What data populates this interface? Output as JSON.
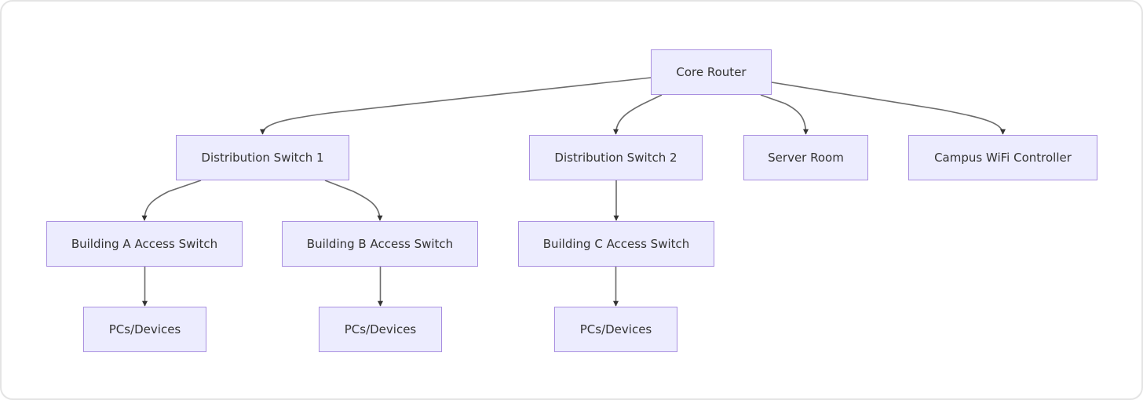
{
  "diagram": {
    "type": "flowchart",
    "direction": "top-down",
    "colors": {
      "node_fill": "#ececfe",
      "node_border": "#a98fe0",
      "edge": "#6b6b6b",
      "text": "#333333"
    },
    "nodes": [
      {
        "id": "core",
        "label": "Core Router"
      },
      {
        "id": "dist1",
        "label": "Distribution Switch 1"
      },
      {
        "id": "dist2",
        "label": "Distribution Switch 2"
      },
      {
        "id": "server",
        "label": "Server Room"
      },
      {
        "id": "wifi",
        "label": "Campus WiFi Controller"
      },
      {
        "id": "accA",
        "label": "Building A Access Switch"
      },
      {
        "id": "accB",
        "label": "Building B Access Switch"
      },
      {
        "id": "accC",
        "label": "Building C Access Switch"
      },
      {
        "id": "pcA",
        "label": "PCs/Devices"
      },
      {
        "id": "pcB",
        "label": "PCs/Devices"
      },
      {
        "id": "pcC",
        "label": "PCs/Devices"
      }
    ],
    "edges": [
      {
        "from": "core",
        "to": "dist1"
      },
      {
        "from": "core",
        "to": "dist2"
      },
      {
        "from": "core",
        "to": "server"
      },
      {
        "from": "core",
        "to": "wifi"
      },
      {
        "from": "dist1",
        "to": "accA"
      },
      {
        "from": "dist1",
        "to": "accB"
      },
      {
        "from": "dist2",
        "to": "accC"
      },
      {
        "from": "accA",
        "to": "pcA"
      },
      {
        "from": "accB",
        "to": "pcB"
      },
      {
        "from": "accC",
        "to": "pcC"
      }
    ]
  }
}
